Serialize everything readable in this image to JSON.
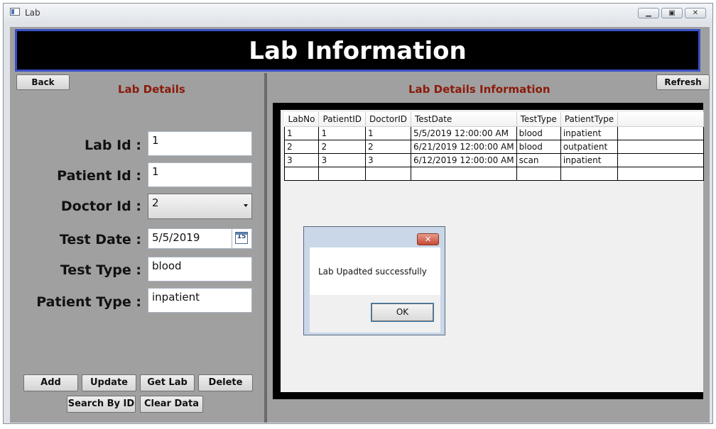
{
  "window": {
    "title": "Lab",
    "controls": {
      "minimize": "▁",
      "restore": "▣",
      "close": "✕"
    }
  },
  "banner": {
    "title": "Lab Information"
  },
  "left_panel": {
    "back_label": "Back",
    "section_title": "Lab Details",
    "labels": {
      "lab_id": "Lab Id :",
      "patient_id": "Patient Id :",
      "doctor_id": "Doctor Id :",
      "test_date": "Test Date :",
      "test_type": "Test Type :",
      "patient_type": "Patient Type :"
    },
    "values": {
      "lab_id": "1",
      "patient_id": "1",
      "doctor_id": "2",
      "test_date": "5/5/2019",
      "calendar_day": "15",
      "test_type": "blood",
      "patient_type": "inpatient"
    },
    "buttons": {
      "add": "Add",
      "update": "Update",
      "get_lab": "Get Lab",
      "delete": "Delete",
      "search_by_id": "Search By ID",
      "clear_data": "Clear Data"
    }
  },
  "right_panel": {
    "refresh_label": "Refresh",
    "section_title": "Lab Details Information",
    "grid": {
      "columns": [
        "LabNo",
        "PatientID",
        "DoctorID",
        "TestDate",
        "TestType",
        "PatientType"
      ],
      "rows": [
        [
          "1",
          "1",
          "1",
          "5/5/2019 12:00:00 AM",
          "blood",
          "inpatient"
        ],
        [
          "2",
          "2",
          "2",
          "6/21/2019 12:00:00 AM",
          "blood",
          "outpatient"
        ],
        [
          "3",
          "3",
          "3",
          "6/12/2019 12:00:00 AM",
          "scan",
          "inpatient"
        ]
      ]
    }
  },
  "dialog": {
    "message": "Lab Upadted successfully",
    "ok_label": "OK",
    "close_glyph": "✕"
  },
  "colors": {
    "section_title": "#8b1a0a",
    "banner_border": "#3950c8",
    "content_bg": "#a0a0a0"
  }
}
